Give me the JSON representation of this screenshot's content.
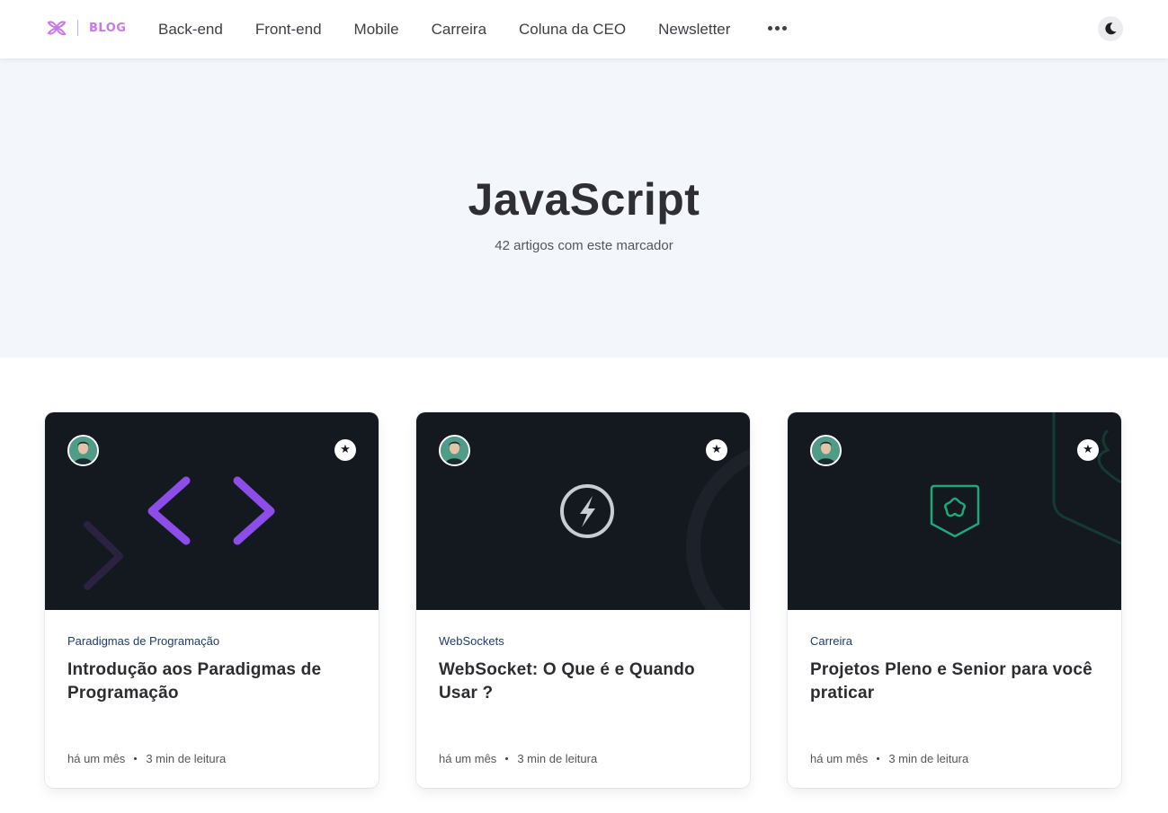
{
  "header": {
    "logo_text": "BLOG",
    "nav": [
      "Back-end",
      "Front-end",
      "Mobile",
      "Carreira",
      "Coluna da CEO",
      "Newsletter"
    ],
    "more_icon": "more-horizontal-icon",
    "theme_icon": "moon-icon"
  },
  "hero": {
    "title": "JavaScript",
    "subtitle": "42 artigos com este marcador"
  },
  "colors": {
    "brand": "#c77be9",
    "cover_bg": "#14181f",
    "hero_bg": "#f3f6fb",
    "accent_purple": "#8c4de8",
    "accent_green": "#22a77a"
  },
  "cards": [
    {
      "tag": "Paradigmas de Programação",
      "title": "Introdução aos Paradigmas de Programação",
      "time": "há um mês",
      "read": "3 min de leitura",
      "cover_icon": "code-brackets-icon"
    },
    {
      "tag": "WebSockets",
      "title": "WebSocket: O Que é e Quando Usar ?",
      "time": "há um mês",
      "read": "3 min de leitura",
      "cover_icon": "socket-bolt-icon"
    },
    {
      "tag": "Carreira",
      "title": "Projetos Pleno e Senior para você praticar",
      "time": "há um mês",
      "read": "3 min de leitura",
      "cover_icon": "badge-flower-icon"
    }
  ]
}
